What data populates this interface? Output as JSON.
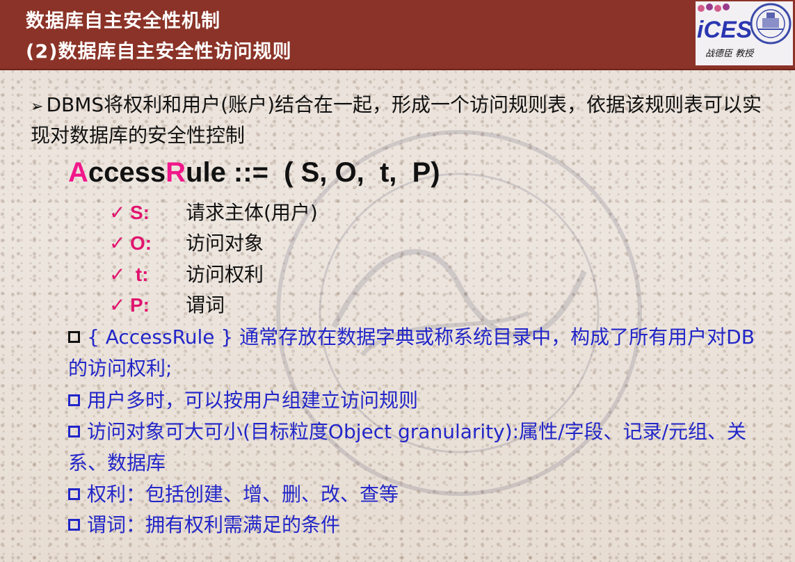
{
  "header": {
    "title_line1": "数据库自主安全性机制",
    "title_line2": "(2)数据库自主安全性访问规则",
    "logo_text": "iCES",
    "logo_caption": "战德臣 教授"
  },
  "body": {
    "intro_bullet": "➢",
    "intro": "DBMS将权利和用户(账户)结合在一起，形成一个访问规则表，依据该规则表可以实现对数据库的安全性控制",
    "formula": {
      "a_initial": "A",
      "a_rest": "ccess",
      "r_initial": "R",
      "r_rest": "ule ::=  ( S, O,  t,  P)"
    },
    "check_glyph": "✓",
    "items": [
      {
        "symbol": "S:",
        "desc": "请求主体(用户)"
      },
      {
        "symbol": "O:",
        "desc": "访问对象"
      },
      {
        "symbol": " t:",
        "desc": "访问权利"
      },
      {
        "symbol": "P:",
        "desc": "谓词"
      }
    ],
    "notes": [
      "{ AccessRule } 通常存放在数据字典或称系统目录中，构成了所有用户对DB的访问权利;",
      "用户多时，可以按用户组建立访问规则",
      "访问对象可大可小(目标粒度Object granularity):属性/字段、记录/元组、关系、数据库",
      "权利：包括创建、增、删、改、查等",
      "谓词：拥有权利需满足的条件"
    ]
  },
  "colors": {
    "header_bg": "#8b3328",
    "accent_pink": "#f0188a",
    "note_blue": "#2226c8"
  }
}
